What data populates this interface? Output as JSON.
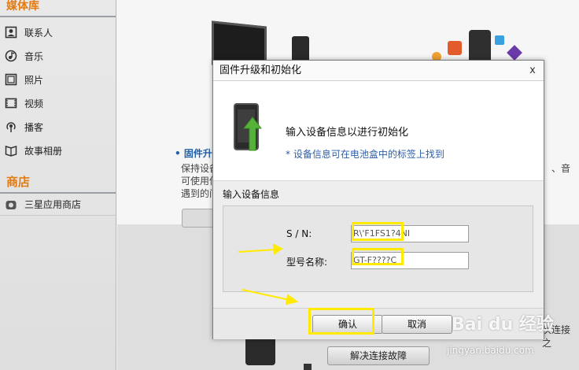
{
  "sidebar": {
    "media_header": "媒体库",
    "items": [
      {
        "label": "联系人",
        "icon": "contacts-icon"
      },
      {
        "label": "音乐",
        "icon": "music-icon"
      },
      {
        "label": "照片",
        "icon": "photo-icon"
      },
      {
        "label": "视频",
        "icon": "video-icon"
      },
      {
        "label": "播客",
        "icon": "podcast-icon"
      },
      {
        "label": "故事相册",
        "icon": "story-album-icon"
      }
    ],
    "store_header": "商店",
    "store_items": [
      {
        "label": "三星应用商店",
        "icon": "store-icon"
      }
    ]
  },
  "background": {
    "firmware_title": "• 固件升级",
    "firmware_desc": "保持设备\n可使用你\n遇到的问",
    "right_fragment": "、音",
    "connection_text": "次连接之",
    "connection_button": "解决连接故障"
  },
  "dialog": {
    "title": "固件升级和初始化",
    "close_glyph": "x",
    "heading": "输入设备信息以进行初始化",
    "hint": "* 设备信息可在电池盒中的标签上找到",
    "section_title": "输入设备信息",
    "fields": [
      {
        "label": "S / N:",
        "value": "R\\'F1FS1?4NI"
      },
      {
        "label": "型号名称:",
        "value": "GT-F????C"
      }
    ],
    "ok_label": "确认",
    "cancel_label": "取消"
  },
  "watermark": {
    "logo": "Bai du 经验",
    "url": "jingyan.baidu.com"
  },
  "colors": {
    "accent_orange": "#e27b12",
    "link_blue": "#2e5ea6",
    "highlight_yellow": "#ffea00",
    "sidebar_bg": "#e4e4e4"
  }
}
